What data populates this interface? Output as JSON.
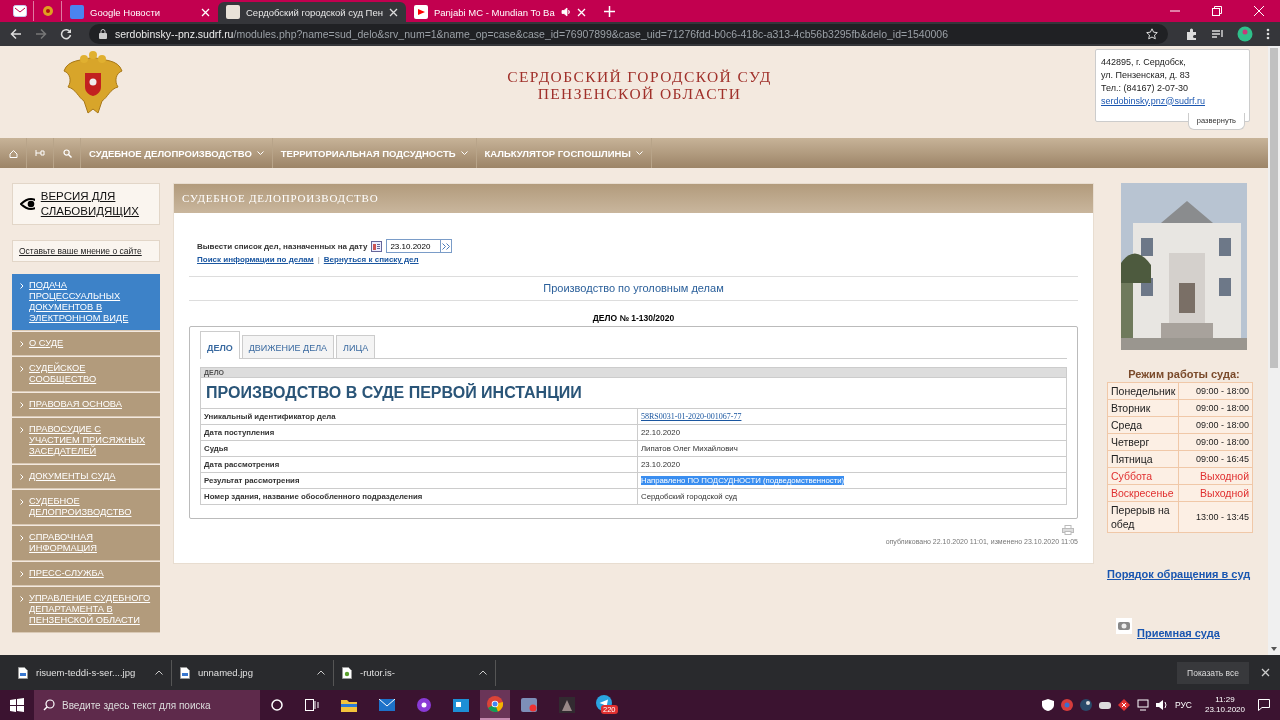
{
  "browser": {
    "tabs": [
      {
        "kind": "pinned",
        "selected": false
      },
      {
        "kind": "pinned",
        "selected": false
      },
      {
        "kind": "page",
        "title": "Google Новости",
        "selected": false,
        "audio": false
      },
      {
        "kind": "page",
        "title": "Сердобский городской суд Пен",
        "selected": true,
        "audio": false
      },
      {
        "kind": "page",
        "title": "Panjabi MC - Mundian To Ba",
        "selected": false,
        "audio": true
      }
    ],
    "url_host": "serdobinsky--pnz.sudrf.ru",
    "url_path": "/modules.php?name=sud_delo&srv_num=1&name_op=case&case_id=76907899&case_uid=71276fdd-b0c6-418c-a313-4cb56b3295fb&delo_id=1540006"
  },
  "header": {
    "title_lines": [
      "СЕРДОБСКИЙ ГОРОДСКОЙ СУД",
      "ПЕНЗЕНСКОЙ ОБЛАСТИ"
    ],
    "contacts": {
      "lines": [
        "442895, г. Сердобск,",
        "ул. Пензенская, д. 83",
        "Тел.: (84167) 2-07-30"
      ],
      "email": "serdobinsky.pnz@sudrf.ru",
      "expand": "развернуть"
    }
  },
  "nav": {
    "menus": [
      "СУДЕБНОЕ ДЕЛОПРОИЗВОДСТВО",
      "ТЕРРИТОРИАЛЬНАЯ ПОДСУДНОСТЬ",
      "КАЛЬКУЛЯТОР ГОСПОШЛИНЫ"
    ]
  },
  "sidebar": {
    "accessibility": "ВЕРСИЯ ДЛЯ СЛАБОВИДЯЩИХ",
    "feedback": "Оставьте ваше мнение о сайте",
    "items": [
      {
        "label": "ПОДАЧА ПРОЦЕССУАЛЬНЫХ ДОКУМЕНТОВ В ЭЛЕКТРОННОМ ВИДЕ",
        "selected": true
      },
      {
        "label": "О СУДЕ",
        "selected": false
      },
      {
        "label": "СУДЕЙСКОЕ СООБЩЕСТВО",
        "selected": false
      },
      {
        "label": "ПРАВОВАЯ ОСНОВА",
        "selected": false
      },
      {
        "label": "ПРАВОСУДИЕ С УЧАСТИЕМ ПРИСЯЖНЫХ ЗАСЕДАТЕЛЕЙ",
        "selected": false
      },
      {
        "label": "ДОКУМЕНТЫ СУДА",
        "selected": false
      },
      {
        "label": "СУДЕБНОЕ ДЕЛОПРОИЗВОДСТВО",
        "selected": false
      },
      {
        "label": "СПРАВОЧНАЯ ИНФОРМАЦИЯ",
        "selected": false
      },
      {
        "label": "ПРЕСС-СЛУЖБА",
        "selected": false
      },
      {
        "label": "УПРАВЛЕНИЕ СУДЕБНОГО ДЕПАРТАМЕНТА В ПЕНЗЕНСКОЙ ОБЛАСТИ",
        "selected": false
      }
    ]
  },
  "content": {
    "title": "СУДЕБНОЕ ДЕЛОПРОИЗВОДСТВО",
    "date_form": {
      "label": "Вывести список дел, назначенных на дату",
      "value": "23.10.2020",
      "links": [
        "Поиск информации по делам",
        "Вернуться к списку дел"
      ],
      "separator": "|"
    },
    "section_title": "Производство по уголовным делам",
    "case_number": "ДЕЛО № 1-130/2020",
    "tabs": [
      {
        "label": "ДЕЛО",
        "selected": true
      },
      {
        "label": "ДВИЖЕНИЕ ДЕЛА",
        "selected": false
      },
      {
        "label": "ЛИЦА",
        "selected": false
      }
    ],
    "case": {
      "caption": "ДЕЛО",
      "heading": "ПРОИЗВОДСТВО В СУДЕ ПЕРВОЙ ИНСТАНЦИИ",
      "rows": [
        {
          "label": "Уникальный идентификатор дела",
          "value": "58RS0031-01-2020-001067-77",
          "kind": "link",
          "highlighted": false
        },
        {
          "label": "Дата поступления",
          "value": "22.10.2020",
          "kind": "text",
          "highlighted": false
        },
        {
          "label": "Судья",
          "value": "Липатов Олег Михайлович",
          "kind": "text",
          "highlighted": false
        },
        {
          "label": "Дата рассмотрения",
          "value": "23.10.2020",
          "kind": "text",
          "highlighted": false
        },
        {
          "label": "Результат рассмотрения",
          "value": "Направлено ПО ПОДСУДНОСТИ (подведомственности)",
          "kind": "text",
          "highlighted": true
        },
        {
          "label": "Номер здания, название обособленного подразделения",
          "value": "Сердобский городской суд",
          "kind": "text",
          "highlighted": false
        }
      ]
    },
    "footer": "опубликовано 22.10.2020 11:01, изменено 23.10.2020 11:05"
  },
  "right": {
    "schedule": {
      "title": "Режим работы суда:",
      "rows": [
        {
          "day": "Понедельник",
          "hours": "09:00 - 18:00",
          "day_off": false
        },
        {
          "day": "Вторник",
          "hours": "09:00 - 18:00",
          "day_off": false
        },
        {
          "day": "Среда",
          "hours": "09:00 - 18:00",
          "day_off": false
        },
        {
          "day": "Четверг",
          "hours": "09:00 - 18:00",
          "day_off": false
        },
        {
          "day": "Пятница",
          "hours": "09:00 - 16:45",
          "day_off": false
        },
        {
          "day": "Суббота",
          "hours": "Выходной",
          "day_off": true
        },
        {
          "day": "Воскресенье",
          "hours": "Выходной",
          "day_off": true
        },
        {
          "day": "Перерыв на обед",
          "hours": "13:00 - 13:45",
          "day_off": false
        }
      ]
    },
    "links": [
      {
        "label": "Порядок обращения в суд",
        "kind": "plain"
      },
      {
        "label": "Приемная суда",
        "kind": "with_icon"
      }
    ]
  },
  "downloads": {
    "items": [
      "risuem-teddi-s-ser....jpg",
      "unnamed.jpg",
      "-rutor.is-"
    ],
    "show_all": "Показать все"
  },
  "taskbar": {
    "search_placeholder": "Введите здесь текст для поиска",
    "badge": "220",
    "language": "РУС",
    "time": "11:29",
    "date": "23.10.2020"
  }
}
